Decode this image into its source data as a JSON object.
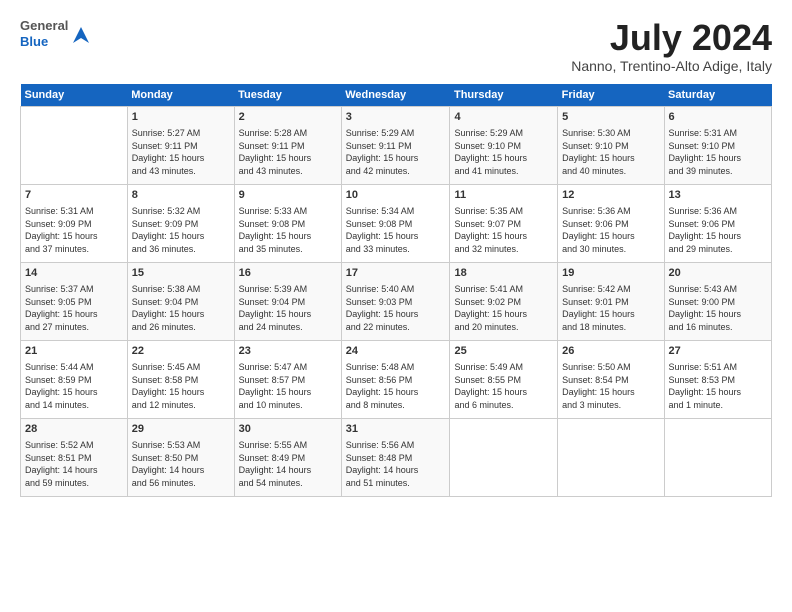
{
  "header": {
    "logo_general": "General",
    "logo_blue": "Blue",
    "month_title": "July 2024",
    "location": "Nanno, Trentino-Alto Adige, Italy"
  },
  "weekdays": [
    "Sunday",
    "Monday",
    "Tuesday",
    "Wednesday",
    "Thursday",
    "Friday",
    "Saturday"
  ],
  "weeks": [
    [
      {
        "day": "",
        "content": ""
      },
      {
        "day": "1",
        "content": "Sunrise: 5:27 AM\nSunset: 9:11 PM\nDaylight: 15 hours\nand 43 minutes."
      },
      {
        "day": "2",
        "content": "Sunrise: 5:28 AM\nSunset: 9:11 PM\nDaylight: 15 hours\nand 43 minutes."
      },
      {
        "day": "3",
        "content": "Sunrise: 5:29 AM\nSunset: 9:11 PM\nDaylight: 15 hours\nand 42 minutes."
      },
      {
        "day": "4",
        "content": "Sunrise: 5:29 AM\nSunset: 9:10 PM\nDaylight: 15 hours\nand 41 minutes."
      },
      {
        "day": "5",
        "content": "Sunrise: 5:30 AM\nSunset: 9:10 PM\nDaylight: 15 hours\nand 40 minutes."
      },
      {
        "day": "6",
        "content": "Sunrise: 5:31 AM\nSunset: 9:10 PM\nDaylight: 15 hours\nand 39 minutes."
      }
    ],
    [
      {
        "day": "7",
        "content": "Sunrise: 5:31 AM\nSunset: 9:09 PM\nDaylight: 15 hours\nand 37 minutes."
      },
      {
        "day": "8",
        "content": "Sunrise: 5:32 AM\nSunset: 9:09 PM\nDaylight: 15 hours\nand 36 minutes."
      },
      {
        "day": "9",
        "content": "Sunrise: 5:33 AM\nSunset: 9:08 PM\nDaylight: 15 hours\nand 35 minutes."
      },
      {
        "day": "10",
        "content": "Sunrise: 5:34 AM\nSunset: 9:08 PM\nDaylight: 15 hours\nand 33 minutes."
      },
      {
        "day": "11",
        "content": "Sunrise: 5:35 AM\nSunset: 9:07 PM\nDaylight: 15 hours\nand 32 minutes."
      },
      {
        "day": "12",
        "content": "Sunrise: 5:36 AM\nSunset: 9:06 PM\nDaylight: 15 hours\nand 30 minutes."
      },
      {
        "day": "13",
        "content": "Sunrise: 5:36 AM\nSunset: 9:06 PM\nDaylight: 15 hours\nand 29 minutes."
      }
    ],
    [
      {
        "day": "14",
        "content": "Sunrise: 5:37 AM\nSunset: 9:05 PM\nDaylight: 15 hours\nand 27 minutes."
      },
      {
        "day": "15",
        "content": "Sunrise: 5:38 AM\nSunset: 9:04 PM\nDaylight: 15 hours\nand 26 minutes."
      },
      {
        "day": "16",
        "content": "Sunrise: 5:39 AM\nSunset: 9:04 PM\nDaylight: 15 hours\nand 24 minutes."
      },
      {
        "day": "17",
        "content": "Sunrise: 5:40 AM\nSunset: 9:03 PM\nDaylight: 15 hours\nand 22 minutes."
      },
      {
        "day": "18",
        "content": "Sunrise: 5:41 AM\nSunset: 9:02 PM\nDaylight: 15 hours\nand 20 minutes."
      },
      {
        "day": "19",
        "content": "Sunrise: 5:42 AM\nSunset: 9:01 PM\nDaylight: 15 hours\nand 18 minutes."
      },
      {
        "day": "20",
        "content": "Sunrise: 5:43 AM\nSunset: 9:00 PM\nDaylight: 15 hours\nand 16 minutes."
      }
    ],
    [
      {
        "day": "21",
        "content": "Sunrise: 5:44 AM\nSunset: 8:59 PM\nDaylight: 15 hours\nand 14 minutes."
      },
      {
        "day": "22",
        "content": "Sunrise: 5:45 AM\nSunset: 8:58 PM\nDaylight: 15 hours\nand 12 minutes."
      },
      {
        "day": "23",
        "content": "Sunrise: 5:47 AM\nSunset: 8:57 PM\nDaylight: 15 hours\nand 10 minutes."
      },
      {
        "day": "24",
        "content": "Sunrise: 5:48 AM\nSunset: 8:56 PM\nDaylight: 15 hours\nand 8 minutes."
      },
      {
        "day": "25",
        "content": "Sunrise: 5:49 AM\nSunset: 8:55 PM\nDaylight: 15 hours\nand 6 minutes."
      },
      {
        "day": "26",
        "content": "Sunrise: 5:50 AM\nSunset: 8:54 PM\nDaylight: 15 hours\nand 3 minutes."
      },
      {
        "day": "27",
        "content": "Sunrise: 5:51 AM\nSunset: 8:53 PM\nDaylight: 15 hours\nand 1 minute."
      }
    ],
    [
      {
        "day": "28",
        "content": "Sunrise: 5:52 AM\nSunset: 8:51 PM\nDaylight: 14 hours\nand 59 minutes."
      },
      {
        "day": "29",
        "content": "Sunrise: 5:53 AM\nSunset: 8:50 PM\nDaylight: 14 hours\nand 56 minutes."
      },
      {
        "day": "30",
        "content": "Sunrise: 5:55 AM\nSunset: 8:49 PM\nDaylight: 14 hours\nand 54 minutes."
      },
      {
        "day": "31",
        "content": "Sunrise: 5:56 AM\nSunset: 8:48 PM\nDaylight: 14 hours\nand 51 minutes."
      },
      {
        "day": "",
        "content": ""
      },
      {
        "day": "",
        "content": ""
      },
      {
        "day": "",
        "content": ""
      }
    ]
  ]
}
